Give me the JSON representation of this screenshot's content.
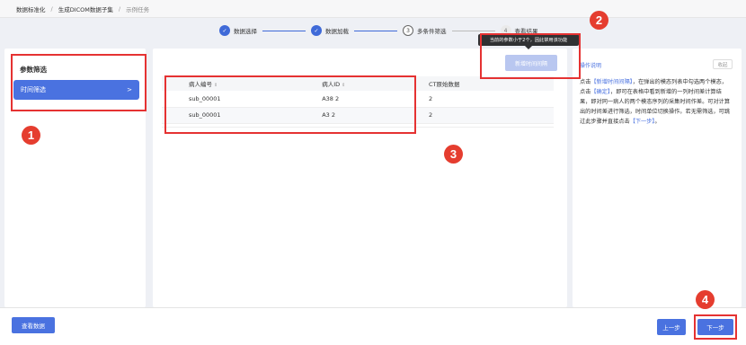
{
  "breadcrumb": [
    "数据标准化",
    "生成DICOM数据子集",
    "示例任务"
  ],
  "steps": [
    {
      "label": "数据选择",
      "status": "done"
    },
    {
      "label": "数据加载",
      "status": "done"
    },
    {
      "label": "多条件筛选",
      "status": "current",
      "num": "3"
    },
    {
      "label": "查看结果",
      "status": "todo",
      "num": "4"
    }
  ],
  "left": {
    "title": "参数筛选",
    "item": "时间筛选",
    "item_arrow": ">"
  },
  "tooltip": "当前的参数小于2个，因此禁用该功能",
  "add_button": "新增时间间隔",
  "table": {
    "headers": [
      "病人编号",
      "病人ID",
      "CT原始数据"
    ],
    "sort_glyph": "⇕",
    "rows": [
      [
        "sub_00001",
        "A38 2",
        "2"
      ],
      [
        "sub_00001",
        "A3 2",
        "2"
      ]
    ]
  },
  "right": {
    "link": "操作说明",
    "collapse": "收起",
    "desc_parts": [
      "点击",
      "【新增时间间隔】",
      "，在弹出的模态列表中勾选两个模态，点击",
      "【确定】",
      "，即可在表格中看到新增的一列时间差计算结果，即对同一病人的两个模态序列的采集时间作差。可对计算出的时间差进行筛选，时间单位切换操作。若无需筛选，可跳过此步骤并直接点击",
      "【下一步】",
      "。"
    ]
  },
  "bottom": {
    "view_data": "查看数据",
    "prev": "上一步",
    "next": "下一步"
  },
  "annotations": [
    "1",
    "2",
    "3",
    "4"
  ],
  "colors": {
    "accent": "#4a72e0",
    "annotation": "#e53232"
  }
}
